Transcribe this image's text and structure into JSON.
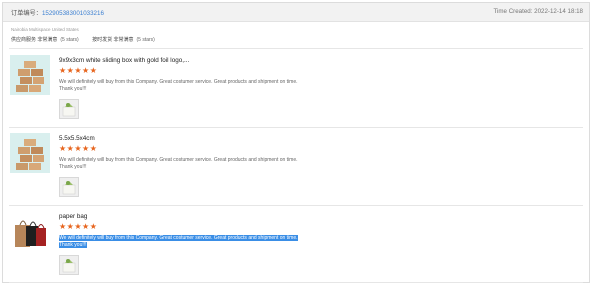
{
  "order": {
    "label": "订单编号：",
    "number": "152905383001033216",
    "time_created": "Time Created: 2022-12-14 18:18"
  },
  "store": {
    "name": "Nairobia Multispace United States",
    "rating1_label": "供应商服务 非常满意",
    "rating1_count": "(5 stars)",
    "rating2_label": "按时发货 非常满意",
    "rating2_count": "(5 stars)"
  },
  "products": [
    {
      "title": "9x9x3cm white sliding box with gold foil logo,...",
      "stars": "★★★★★",
      "review": "We will definitely will buy from this Company. Great costumer service. Great products and shipment on time. Thank you!!!",
      "thumb_icon": "stacked-boxes-icon",
      "photo_icon": "review-photo-icon"
    },
    {
      "title": "5.5x5.5x4cm",
      "stars": "★★★★★",
      "review": "We will definitely will buy from this Company. Great costumer service. Great products and shipment on time. Thank you!!!",
      "thumb_icon": "stacked-boxes-icon",
      "photo_icon": "review-photo-icon"
    },
    {
      "title": "paper bag",
      "stars": "★★★★★",
      "review": "We will definitely will buy from this Company. Great costumer service. Great products and shipment on time. Thank you!!!",
      "review_highlighted": true,
      "thumb_icon": "paper-bags-icon",
      "photo_icon": "review-photo-icon"
    }
  ],
  "colors": {
    "star": "#e7641d",
    "link": "#3b7fd1",
    "selection": "#3a8ee6"
  }
}
